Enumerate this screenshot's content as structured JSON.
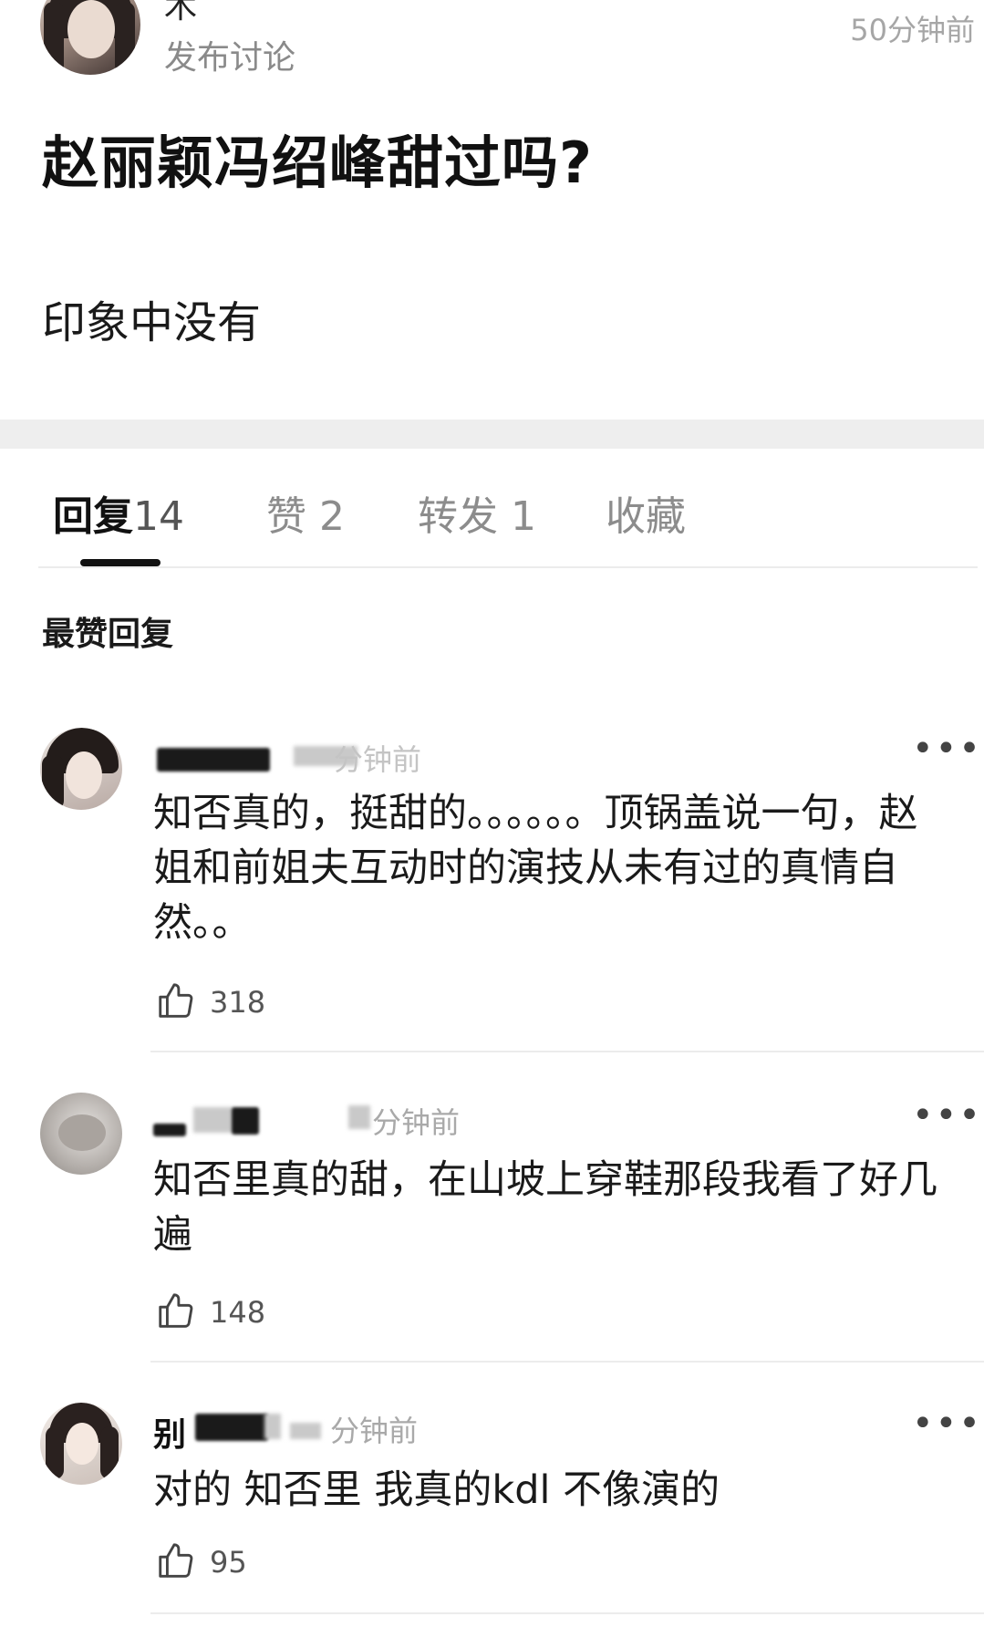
{
  "post": {
    "author_name": "木",
    "action": "发布讨论",
    "time": "50分钟前",
    "title": "赵丽颖冯绍峰甜过吗?",
    "body": "印象中没有"
  },
  "tabs": [
    {
      "label": "回复",
      "count": "14"
    },
    {
      "label": "赞",
      "count": "2"
    },
    {
      "label": "转发",
      "count": "1"
    },
    {
      "label": "收藏",
      "count": ""
    }
  ],
  "section_title": "最赞回复",
  "comments": [
    {
      "name": "",
      "time": "分钟前",
      "text": "知否真的，挺甜的。。。。。。顶锅盖说一句，赵姐和前姐夫互动时的演技从未有过的真情自然。。",
      "likes": "318"
    },
    {
      "name": "",
      "time": "分钟前",
      "text": "知否里真的甜，在山坡上穿鞋那段我看了好几遍",
      "likes": "148"
    },
    {
      "name": "别",
      "time": "分钟前",
      "text": "对的 知否里 我真的kdl 不像演的",
      "likes": "95"
    }
  ],
  "icons": {
    "like": "thumbs-up-icon",
    "more": "more-dots-icon"
  }
}
